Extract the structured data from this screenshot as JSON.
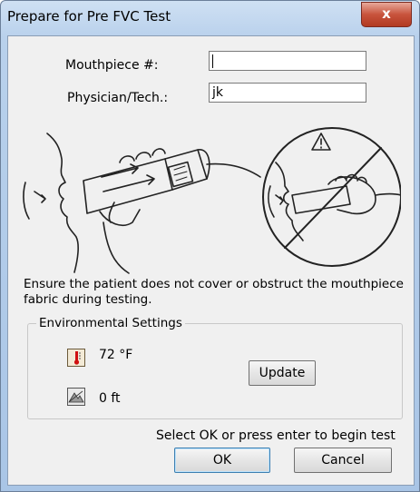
{
  "window": {
    "title": "Prepare for Pre FVC Test",
    "close_glyph": "x"
  },
  "form": {
    "mouthpiece_label": "Mouthpiece #:",
    "mouthpiece_value": "",
    "physician_label": "Physician/Tech.:",
    "physician_value": "jk"
  },
  "instruction": "Ensure the patient does not cover or obstruct the mouthpiece fabric during testing.",
  "environment": {
    "group_title": "Environmental Settings",
    "temperature": "72 °F",
    "temperature_icon": "thermometer-icon",
    "altitude": "0 ft",
    "altitude_icon": "mountain-icon",
    "update_label": "Update"
  },
  "footer": {
    "prompt": "Select OK or press enter to begin test",
    "ok_label": "OK",
    "cancel_label": "Cancel"
  },
  "colors": {
    "accent": "#3c7fb1",
    "close_button": "#c8533c",
    "thermometer_red": "#d01010"
  }
}
